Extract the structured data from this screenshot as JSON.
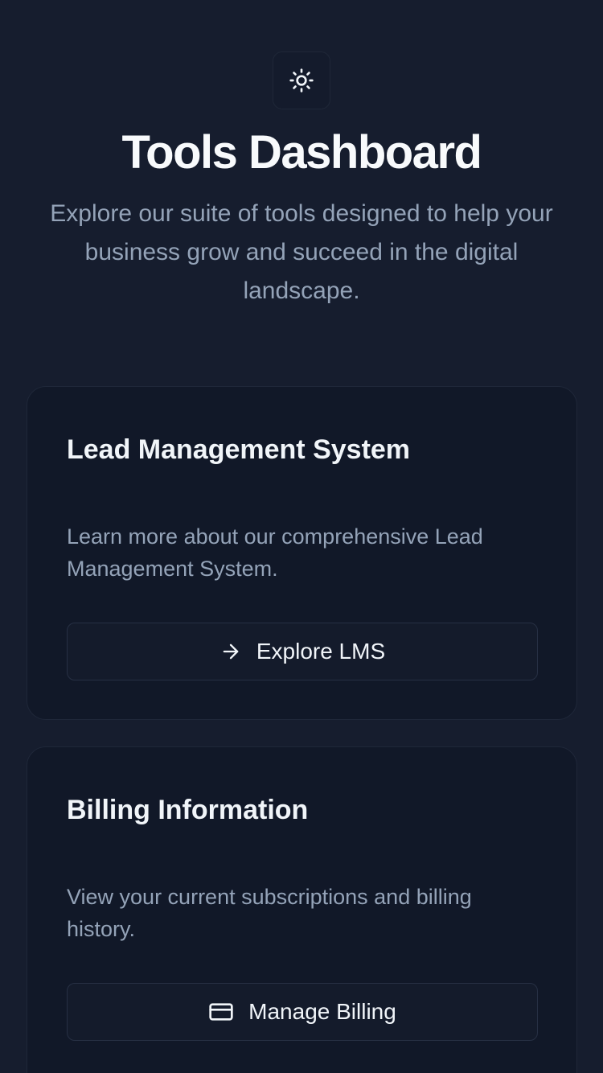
{
  "header": {
    "theme_toggle_icon": "sun-icon",
    "title": "Tools Dashboard",
    "subtitle": "Explore our suite of tools designed to help your business grow and succeed in the digital landscape."
  },
  "cards": [
    {
      "title": "Lead Management System",
      "description": "Learn more about our comprehensive Lead Management System.",
      "button_label": "Explore LMS",
      "button_icon": "arrow-right-icon"
    },
    {
      "title": "Billing Information",
      "description": "View your current subscriptions and billing history.",
      "button_label": "Manage Billing",
      "button_icon": "credit-card-icon"
    }
  ],
  "colors": {
    "background": "#161d2e",
    "card_background": "#111828",
    "title_text": "#f8fafc",
    "muted_text": "#94a3b8"
  }
}
